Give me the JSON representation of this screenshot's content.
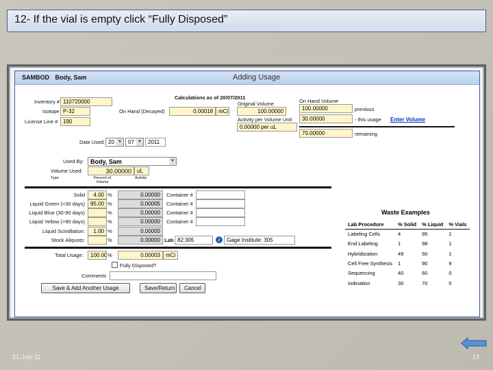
{
  "slide": {
    "title": "12- If the vial is empty click “Fully Disposed”",
    "date": "21-July-11",
    "page": "13"
  },
  "header": {
    "user_code": "SAMBOD",
    "user_name": "Body, Sam",
    "title": "Adding Usage"
  },
  "form": {
    "inventory_label": "Inventory #",
    "inventory_value": "110720000",
    "isotope_label": "Isotope",
    "isotope_value": "P-32",
    "license_label": "License Line #",
    "license_value": "190",
    "calc_title": "Calculations as of 20/07/2011",
    "on_hand_decayed_label": "On Hand (Decayed)",
    "on_hand_decayed_value": "0.00018",
    "unit_mci": "mCi",
    "original_volume_label": "Original Volume",
    "original_volume_value": "100.00000",
    "activity_per_volume_label": "Activity per Volume Unit",
    "activity_per_volume_value": "0.00000 per uL",
    "on_hand_volume_label": "On Hand Volume",
    "on_hand_previous_value": "100.00000",
    "previous_label": "previous",
    "this_usage_value": "30.00000",
    "this_usage_label": "- this usage",
    "enter_volume_link": "Enter Volume",
    "remaining_value": "70.00000",
    "remaining_label": "remaining",
    "date_used_label": "Date Used",
    "date_day": "20",
    "date_month": "07",
    "date_year": "2011",
    "used_by_label": "Used By:",
    "used_by_value": "Body, Sam",
    "volume_used_label": "Volume Used:",
    "volume_used_value": "30.00000",
    "volume_unit": "uL",
    "col_type": "Type",
    "col_percent_line1": "Percent of",
    "col_percent_line2": "Volume",
    "col_activity": "Activity",
    "percent_sign": "%",
    "rows": [
      {
        "label": "Solid",
        "percent": "4.00",
        "activity": "0.00000",
        "container_label": "Container #",
        "container": ""
      },
      {
        "label": "Liquid Green (<30 days)",
        "percent": "95.00",
        "activity": "0.00005",
        "container_label": "Container #",
        "container": ""
      },
      {
        "label": "Liquid Blue (30-90 days)",
        "percent": "",
        "activity": "0.00000",
        "container_label": "Container #",
        "container": ""
      },
      {
        "label": "Liquid Yellow (>90 days)",
        "percent": "",
        "activity": "0.00000",
        "container_label": "Container #",
        "container": ""
      },
      {
        "label": "Liquid Scintillation:",
        "percent": "1.00",
        "activity": "0.00000",
        "container_label": "",
        "container": ""
      },
      {
        "label": "Stock Aliquots:",
        "percent": "",
        "activity": "0.00000",
        "container_label": "",
        "container": ""
      }
    ],
    "lab_label": "Lab",
    "lab_value": "82:305",
    "gage_value": "Gage Institute:  305",
    "total_usage_label": "Total Usage:",
    "total_usage_percent": "100.00",
    "total_usage_activity": "0.00003",
    "fully_disposed_label": "Fully Disposed?",
    "comments_label": "Comments",
    "comments_value": "",
    "btn_save_add": "Save & Add Another Usage",
    "btn_save_return": "Save/Return",
    "btn_cancel": "Cancel"
  },
  "waste": {
    "title": "Waste Examples",
    "headers": [
      "Lab Procedure",
      "% Solid",
      "% Liquid",
      "% Vials"
    ],
    "rows": [
      [
        "Labeling Cells",
        "4",
        "95",
        "1"
      ],
      [
        "End Labeling",
        "1",
        "98",
        "1"
      ],
      [
        "Hybridization",
        "49",
        "50",
        "1"
      ],
      [
        "Cell Free Synthesis",
        "1",
        "90",
        "9"
      ],
      [
        "Sequencing",
        "40",
        "60",
        "0"
      ],
      [
        "Iodination",
        "30",
        "70",
        "0"
      ]
    ]
  },
  "colors": {
    "accent_link": "#0033cc",
    "yellow_field": "#fff5c8",
    "header_blue": "#bcd0ee"
  },
  "icons": [
    "info-icon",
    "back-arrow-icon",
    "chevron-down-icon"
  ]
}
